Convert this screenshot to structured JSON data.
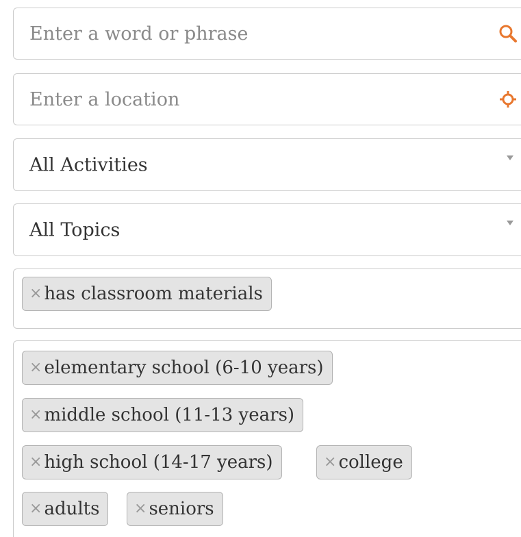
{
  "search": {
    "placeholder": "Enter a word or phrase",
    "icon": "search-icon"
  },
  "location": {
    "placeholder": "Enter a location",
    "icon": "crosshair-icon"
  },
  "activities": {
    "selected": "All Activities"
  },
  "topics": {
    "selected": "All Topics"
  },
  "materials": {
    "tags": [
      {
        "label": "has classroom materials",
        "remove": "×"
      }
    ]
  },
  "ages": {
    "tags": [
      {
        "label": "elementary school (6-10 years)",
        "remove": "×"
      },
      {
        "label": "middle school (11-13 years)",
        "remove": "×"
      },
      {
        "label": "high school (14-17 years)",
        "remove": "×"
      },
      {
        "label": "college",
        "remove": "×"
      },
      {
        "label": "adults",
        "remove": "×"
      },
      {
        "label": "seniors",
        "remove": "×"
      }
    ]
  },
  "colors": {
    "accent": "#e8772e",
    "border": "#cccccc",
    "tag_bg": "#e4e4e4",
    "text": "#333333",
    "placeholder": "#8a8a8a"
  }
}
